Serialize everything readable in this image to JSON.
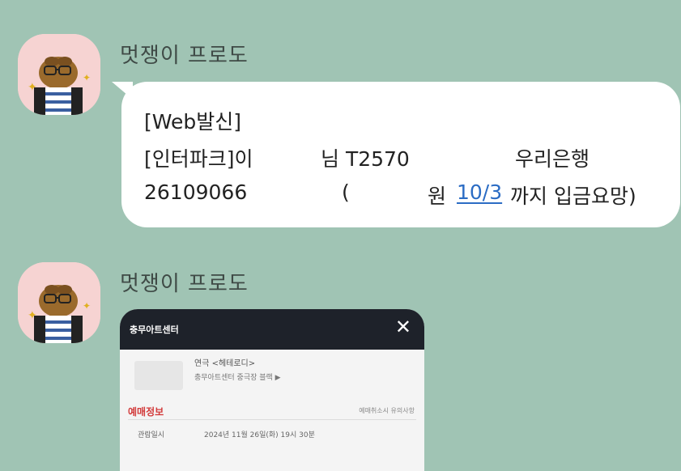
{
  "messages": [
    {
      "sender": "멋쟁이 프로도",
      "text": {
        "line1": "[Web발신]",
        "line2": {
          "a": "[인터파크]이",
          "b": "님 T2570",
          "c": "우리은행"
        },
        "line3": {
          "a": "26109066",
          "b": "(",
          "c": "원",
          "date": "10/3",
          "d": "까지 입금요망)"
        }
      }
    },
    {
      "sender": "멋쟁이 프로도",
      "image": {
        "title": "충무아트센터",
        "close": "✕",
        "venue": "연극 <헤테로디>",
        "venue_sub": "충무아트센터 중극장 블랙 ▶",
        "section_title": "예매정보",
        "section_note": "예매취소시 유의사항",
        "row_label": "관람일시",
        "row_value": "2024년 11월 26일(화) 19시 30분"
      }
    }
  ],
  "colors": {
    "background": "#a0c4b4",
    "bubble": "#ffffff",
    "avatar_bg": "#f6d3d2",
    "link": "#2b6cc4"
  },
  "icons": {
    "avatar": "frodo-character-icon",
    "close": "close-icon"
  }
}
